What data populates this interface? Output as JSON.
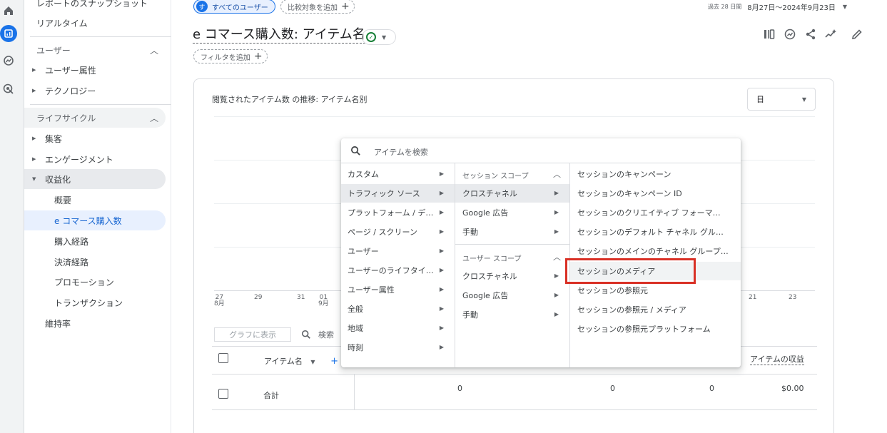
{
  "rail": {
    "icons": [
      "home-icon",
      "reports-icon",
      "explore-icon",
      "advertising-icon"
    ]
  },
  "sidebar": {
    "snapshot": "レポートのスナップショット",
    "realtime": "リアルタイム",
    "user_section": "ユーザー",
    "user_items": [
      "ユーザー属性",
      "テクノロジー"
    ],
    "lifecycle_section": "ライフサイクル",
    "lifecycle_items": [
      "集客",
      "エンゲージメント",
      "収益化"
    ],
    "monetization_items": [
      "概要",
      "e コマース購入数",
      "購入経路",
      "決済経路",
      "プロモーション",
      "トランザクション"
    ],
    "retention": "維持率"
  },
  "header": {
    "segment_badge": "す",
    "segment_label": "すべてのユーザー",
    "add_comparison": "比較対象を追加",
    "date_prefix": "過去 28 日間",
    "date_range": "8月27日～2024年9月23日",
    "title": "e コマース購入数: アイテム名",
    "add_filter": "フィルタを追加"
  },
  "chart": {
    "title": "閲覧されたアイテム数 の推移: アイテム名別",
    "unit": "日",
    "x_ticks": [
      {
        "d": "27",
        "m": "8月"
      },
      {
        "d": "29",
        "m": ""
      },
      {
        "d": "31",
        "m": ""
      },
      {
        "d": "01",
        "m": "9月"
      },
      {
        "d": "21",
        "m": ""
      },
      {
        "d": "23",
        "m": ""
      }
    ]
  },
  "table": {
    "plot_button": "グラフに表示",
    "search_label": "検索",
    "col_item_name": "アイテム名",
    "col_item_revenue": "アイテムの収益",
    "total_label": "合計",
    "totals": [
      "0",
      "0",
      "0",
      "$0.00"
    ]
  },
  "menu": {
    "search_placeholder": "アイテムを検索",
    "col1": [
      "カスタム",
      "トラフィック ソース",
      "プラットフォーム / デ…",
      "ページ / スクリーン",
      "ユーザー",
      "ユーザーのライフタイ…",
      "ユーザー属性",
      "全般",
      "地域",
      "時刻"
    ],
    "col2_session_scope": "セッション スコープ",
    "col2_session_items": [
      "クロスチャネル",
      "Google 広告",
      "手動"
    ],
    "col2_user_scope": "ユーザー スコープ",
    "col2_user_items": [
      "クロスチャネル",
      "Google 広告",
      "手動"
    ],
    "col3": [
      "セッションのキャンペーン",
      "セッションのキャンペーン ID",
      "セッションのクリエイティブ フォーマ…",
      "セッションのデフォルト チャネル グル…",
      "セッションのメインのチャネル グループ…",
      "セッションのメディア",
      "セッションの参照元",
      "セッションの参照元 / メディア",
      "セッションの参照元プラットフォーム"
    ]
  },
  "colors": {
    "accent": "#1a73e8",
    "highlight": "#d93025",
    "selected": "#e8eaed"
  }
}
